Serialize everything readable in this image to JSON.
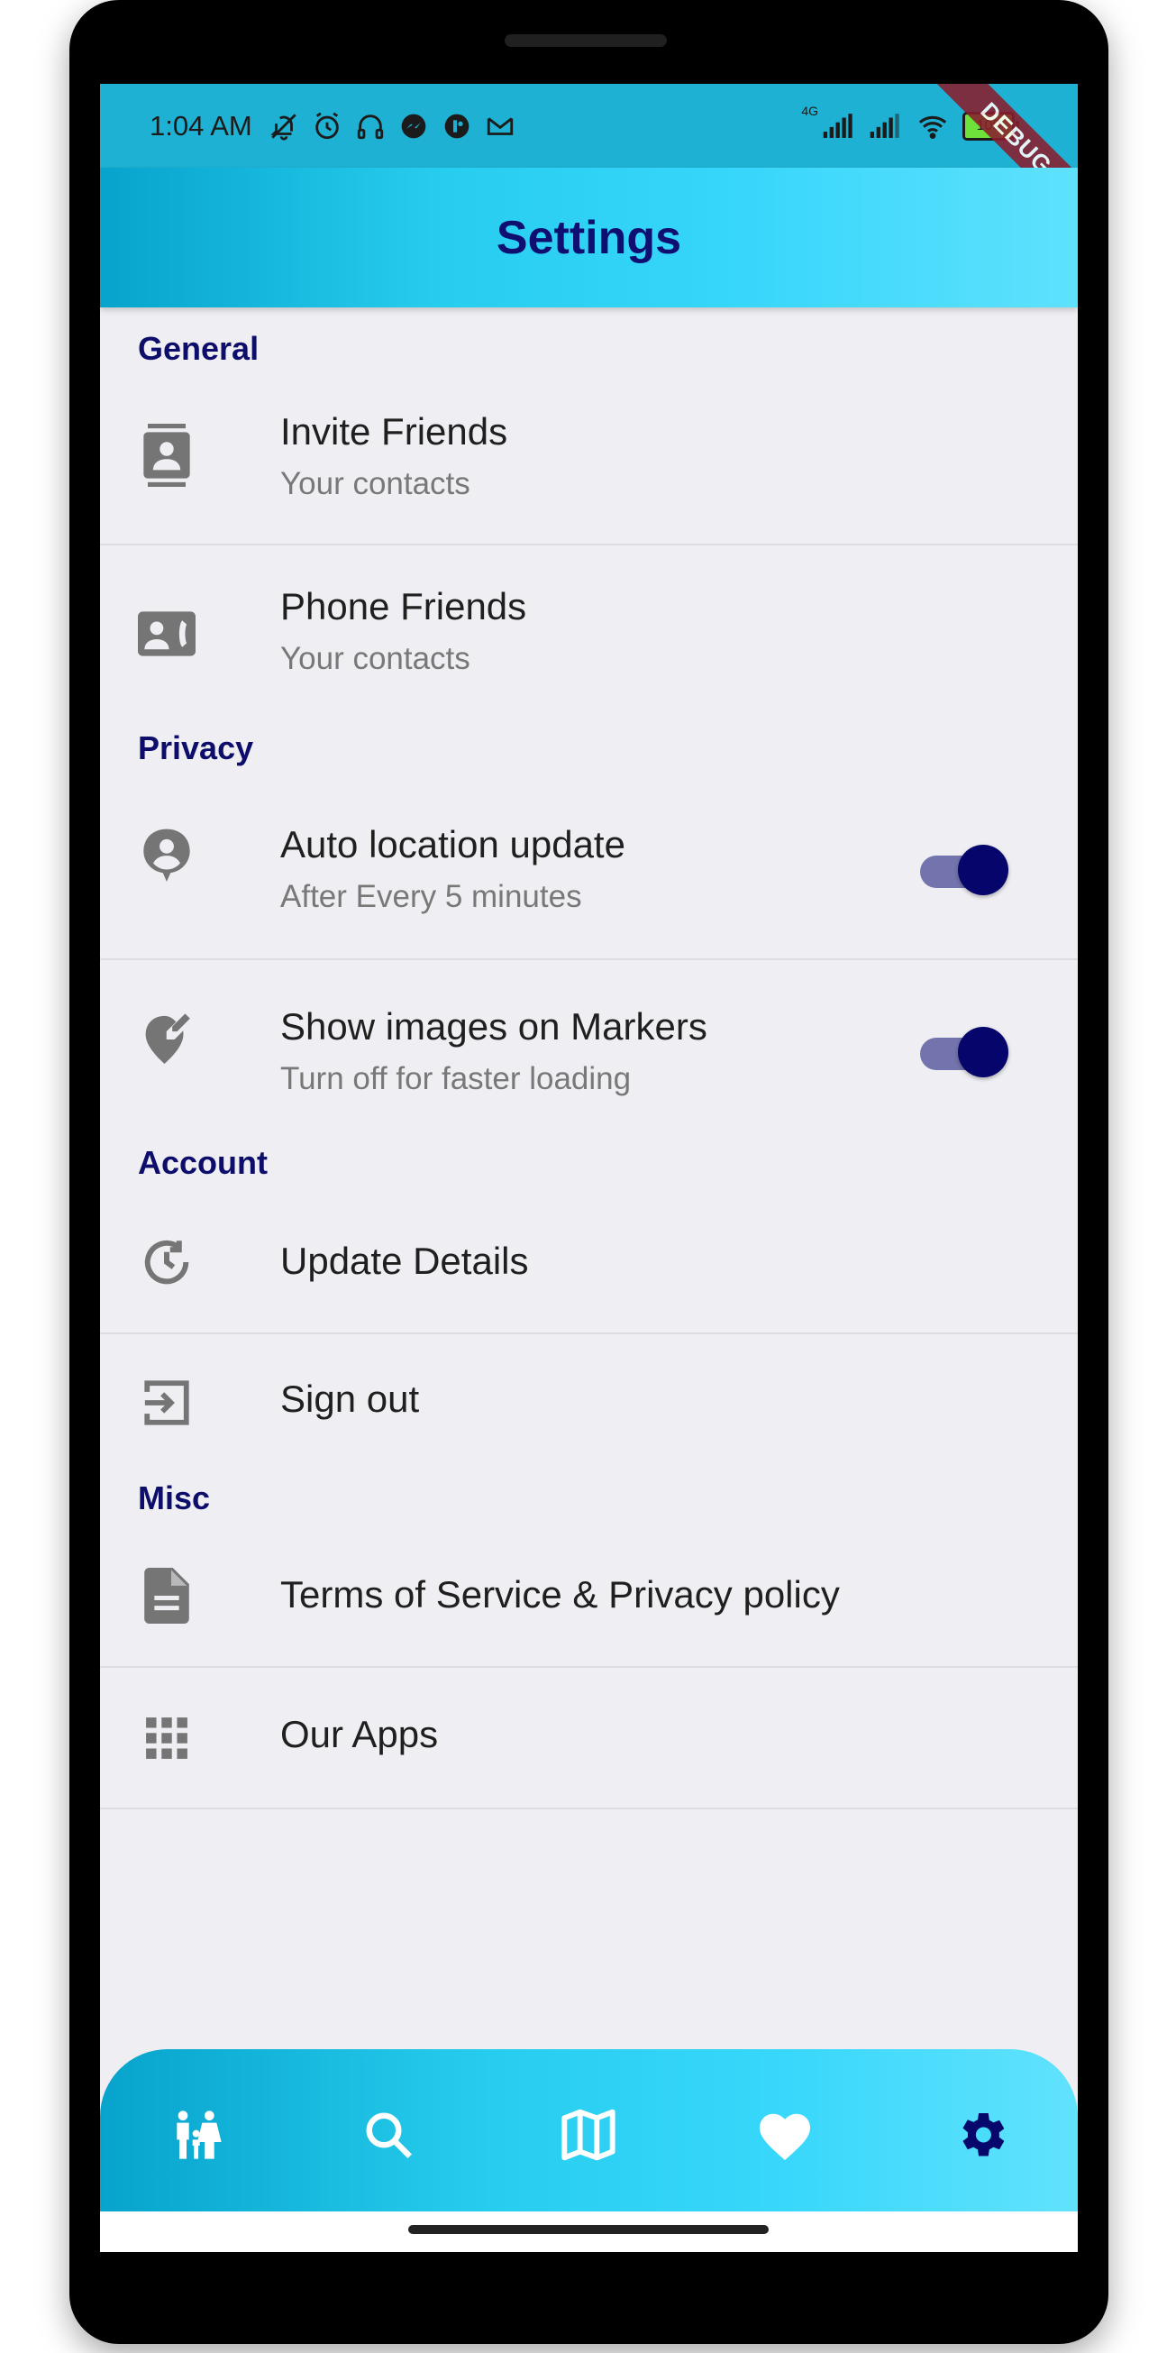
{
  "status_bar": {
    "time": "1:04 AM",
    "left_icons": [
      "notifications-off-icon",
      "alarm-icon",
      "headset-icon",
      "messenger-icon",
      "app-icon",
      "gmail-icon"
    ],
    "network_label": "4G",
    "battery": "100",
    "debug_banner": "DEBUG"
  },
  "app_bar": {
    "title": "Settings"
  },
  "sections": {
    "general": "General",
    "privacy": "Privacy",
    "account": "Account",
    "misc": "Misc"
  },
  "items": {
    "invite_friends": {
      "title": "Invite Friends",
      "subtitle": "Your contacts",
      "icon": "contacts-icon"
    },
    "phone_friends": {
      "title": "Phone Friends",
      "subtitle": "Your contacts",
      "icon": "contact-phone-icon"
    },
    "auto_location": {
      "title": "Auto location update",
      "subtitle": "After Every 5 minutes",
      "icon": "person-pin-icon",
      "toggle_on": true
    },
    "show_images": {
      "title": "Show images on Markers",
      "subtitle": "Turn off for faster loading",
      "icon": "edit-location-icon",
      "toggle_on": true
    },
    "update_details": {
      "title": "Update Details",
      "icon": "history-icon"
    },
    "sign_out": {
      "title": "Sign out",
      "icon": "exit-to-app-icon"
    },
    "terms": {
      "title": "Terms of Service & Privacy policy",
      "icon": "document-icon"
    },
    "our_apps": {
      "title": "Our Apps",
      "icon": "apps-grid-icon"
    }
  },
  "bottom_nav": {
    "items": [
      "family-icon",
      "search-icon",
      "map-icon",
      "heart-icon",
      "settings-icon"
    ],
    "active": "settings-icon"
  },
  "colors": {
    "accent_dark": "#0d0d6b",
    "app_bar_start": "#07a3cc",
    "app_bar_end": "#5ee1fd",
    "switch_thumb": "#05056b",
    "switch_track": "#7373ad",
    "icon_grey": "#757575"
  }
}
